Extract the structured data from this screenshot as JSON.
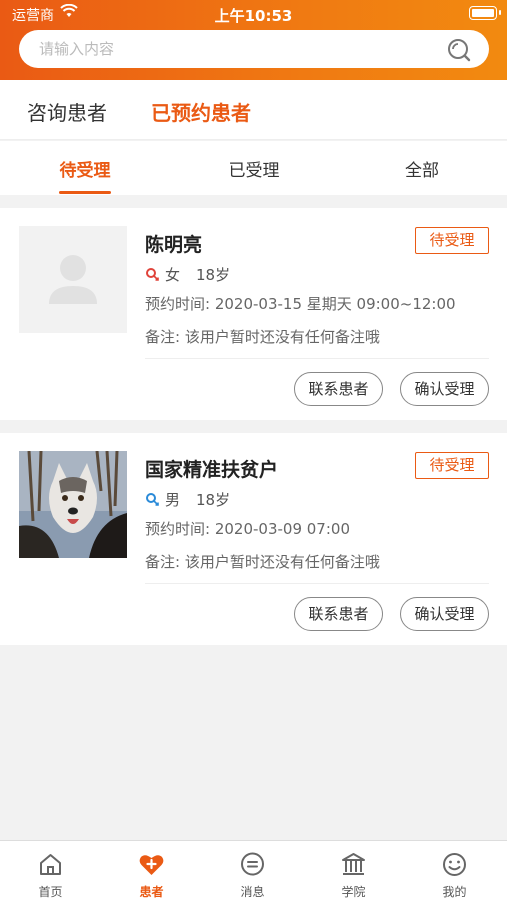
{
  "status_bar": {
    "carrier": "运营商",
    "time": "上午10:53"
  },
  "search": {
    "placeholder": "请输入内容"
  },
  "top_tabs": [
    {
      "label": "咨询患者",
      "active": false
    },
    {
      "label": "已预约患者",
      "active": true
    }
  ],
  "sub_tabs": [
    {
      "label": "待受理",
      "active": true
    },
    {
      "label": "已受理",
      "active": false
    },
    {
      "label": "全部",
      "active": false
    }
  ],
  "patients": [
    {
      "name": "陈明亮",
      "status": "待受理",
      "gender": "女",
      "gender_icon": "female-icon",
      "age": "18岁",
      "appointment": "预约时间: 2020-03-15 星期天 09:00~12:00",
      "note": "备注: 该用户暂时还没有任何备注哦",
      "contact_label": "联系患者",
      "confirm_label": "确认受理",
      "avatar": "placeholder-avatar"
    },
    {
      "name": "国家精准扶贫户",
      "status": "待受理",
      "gender": "男",
      "gender_icon": "male-icon",
      "age": "18岁",
      "appointment": "预约时间: 2020-03-09 07:00",
      "note": "备注: 该用户暂时还没有任何备注哦",
      "contact_label": "联系患者",
      "confirm_label": "确认受理",
      "avatar": "husky-dog-photo"
    }
  ],
  "tabbar": [
    {
      "label": "首页",
      "icon": "home-icon",
      "active": false
    },
    {
      "label": "患者",
      "icon": "heart-plus-icon",
      "active": true
    },
    {
      "label": "消息",
      "icon": "message-icon",
      "active": false
    },
    {
      "label": "学院",
      "icon": "institution-icon",
      "active": false
    },
    {
      "label": "我的",
      "icon": "smiley-icon",
      "active": false
    }
  ],
  "colors": {
    "accent": "#ea5a14",
    "header_gradient_end": "#f28a10",
    "male": "#2a8ad8",
    "female": "#e0433a"
  }
}
